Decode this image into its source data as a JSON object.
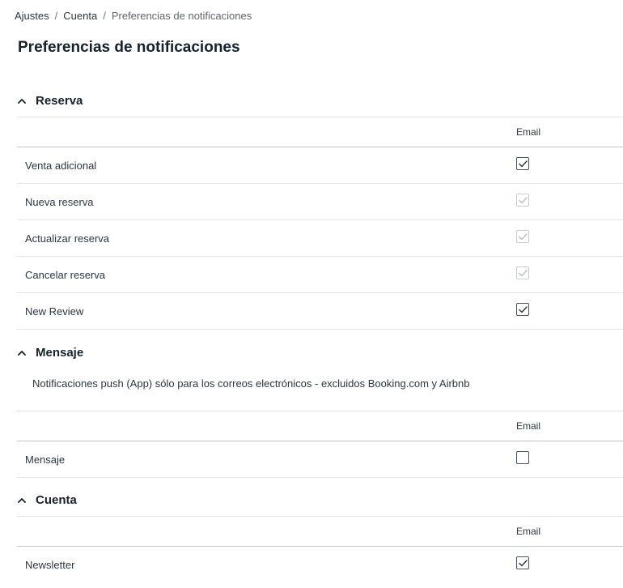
{
  "breadcrumb": {
    "items": [
      "Ajustes",
      "Cuenta",
      "Preferencias de notificaciones"
    ],
    "separator": "/"
  },
  "page": {
    "title": "Preferencias de notificaciones"
  },
  "sections": {
    "reserva": {
      "title": "Reserva",
      "column": "Email",
      "rows": [
        {
          "label": "Venta adicional",
          "checked": true,
          "disabled": false
        },
        {
          "label": "Nueva reserva",
          "checked": true,
          "disabled": true
        },
        {
          "label": "Actualizar reserva",
          "checked": true,
          "disabled": true
        },
        {
          "label": "Cancelar reserva",
          "checked": true,
          "disabled": true
        },
        {
          "label": "New Review",
          "checked": true,
          "disabled": false
        }
      ]
    },
    "mensaje": {
      "title": "Mensaje",
      "note": "Notificaciones push (App) sólo para los correos electrónicos - excluidos Booking.com y Airbnb",
      "column": "Email",
      "rows": [
        {
          "label": "Mensaje",
          "checked": false,
          "disabled": false
        }
      ]
    },
    "cuenta": {
      "title": "Cuenta",
      "column": "Email",
      "rows": [
        {
          "label": "Newsletter",
          "checked": true,
          "disabled": false
        }
      ]
    }
  },
  "icons": {
    "collapse": "chevron-up-icon",
    "check": "check-icon"
  },
  "colors": {
    "check_enabled": "#2f3a44",
    "check_disabled": "#b9bfc4",
    "border": "#4b5560"
  }
}
